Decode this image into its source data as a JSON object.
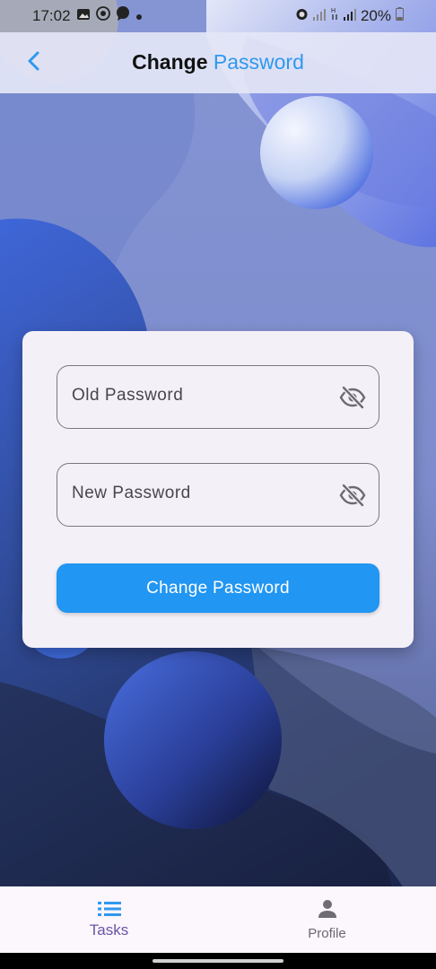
{
  "status_bar": {
    "time": "17:02",
    "battery": "20%",
    "icons_left": [
      "gallery-icon",
      "whatsapp-icon",
      "chat-icon",
      "dot-icon"
    ],
    "icons_right": [
      "alarm-icon",
      "signal-icon",
      "data-icon",
      "signal-icon",
      "battery-icon"
    ]
  },
  "app_bar": {
    "title_part1": "Change",
    "title_part2": "Password",
    "back_icon": "chevron-left-icon",
    "accent": "#2f98ee"
  },
  "form": {
    "old_password_label": "Old Password",
    "new_password_label": "New Password",
    "visibility_icon": "eye-off-icon",
    "submit_label": "Change Password",
    "button_color": "#2196f3"
  },
  "bottom_nav": {
    "items": [
      {
        "label": "Tasks",
        "icon": "list-icon",
        "active": true
      },
      {
        "label": "Profile",
        "icon": "person-icon",
        "active": false
      }
    ]
  }
}
